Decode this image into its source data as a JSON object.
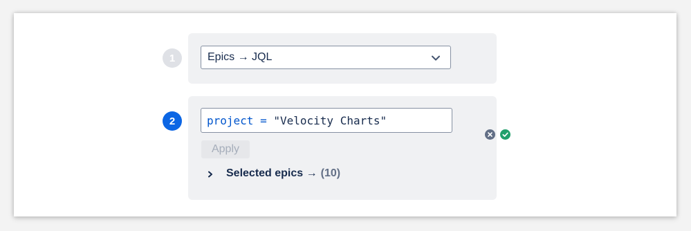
{
  "steps": [
    {
      "number": "1",
      "state": "inactive"
    },
    {
      "number": "2",
      "state": "active"
    }
  ],
  "source_select": {
    "value": "Epics → JQL",
    "icon": "chevron-down-icon"
  },
  "jql": {
    "field": "project",
    "operator": "=",
    "value": "\"Velocity Charts\"",
    "clear_icon": "clear-icon",
    "valid_icon": "valid-check-icon"
  },
  "apply_button": {
    "label": "Apply",
    "disabled": true
  },
  "selected_epics": {
    "label": "Selected epics →",
    "count": "(10)",
    "icon": "chevron-right-icon"
  },
  "colors": {
    "active_step": "#0c66e4",
    "inactive_step": "#dfe1e6",
    "panel_bg": "#f0f1f3",
    "valid": "#22a06b",
    "clear": "#626f86",
    "jql_keyword": "#0055cc"
  }
}
